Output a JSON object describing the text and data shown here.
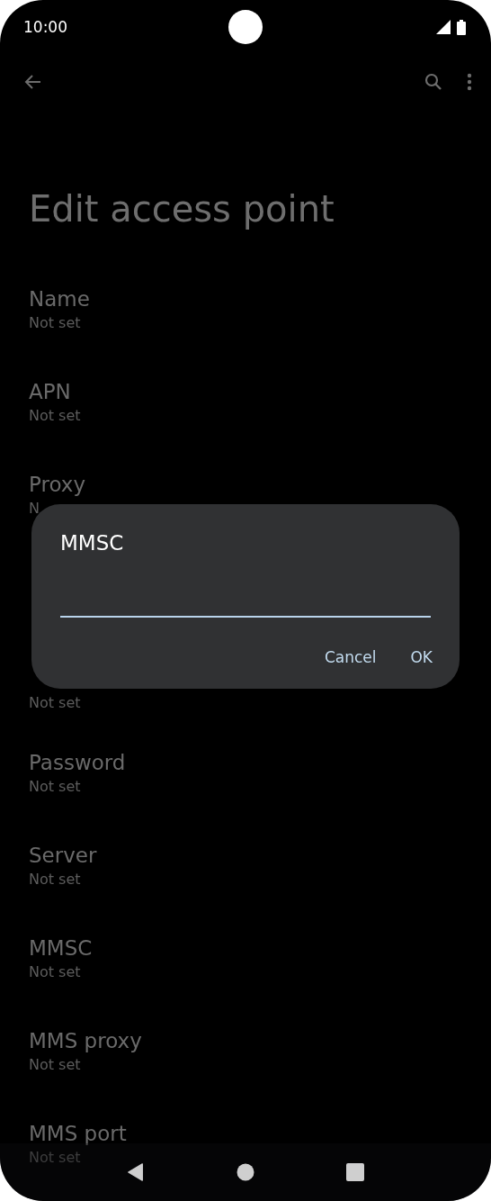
{
  "status_bar": {
    "time": "10:00"
  },
  "page_title": "Edit access point",
  "items": [
    {
      "title": "Name",
      "subtitle": "Not set"
    },
    {
      "title": "APN",
      "subtitle": "Not set"
    },
    {
      "title": "Proxy",
      "subtitle": "N"
    },
    {
      "subtitle": "Not set"
    },
    {
      "title": "Password",
      "subtitle": "Not set"
    },
    {
      "title": "Server",
      "subtitle": "Not set"
    },
    {
      "title": "MMSC",
      "subtitle": "Not set"
    },
    {
      "title": "MMS proxy",
      "subtitle": "Not set"
    },
    {
      "title": "MMS port",
      "subtitle": "Not set"
    }
  ],
  "dialog": {
    "title": "MMSC",
    "field": {
      "focused": true
    },
    "buttons": [
      "Cancel",
      "OK"
    ]
  }
}
